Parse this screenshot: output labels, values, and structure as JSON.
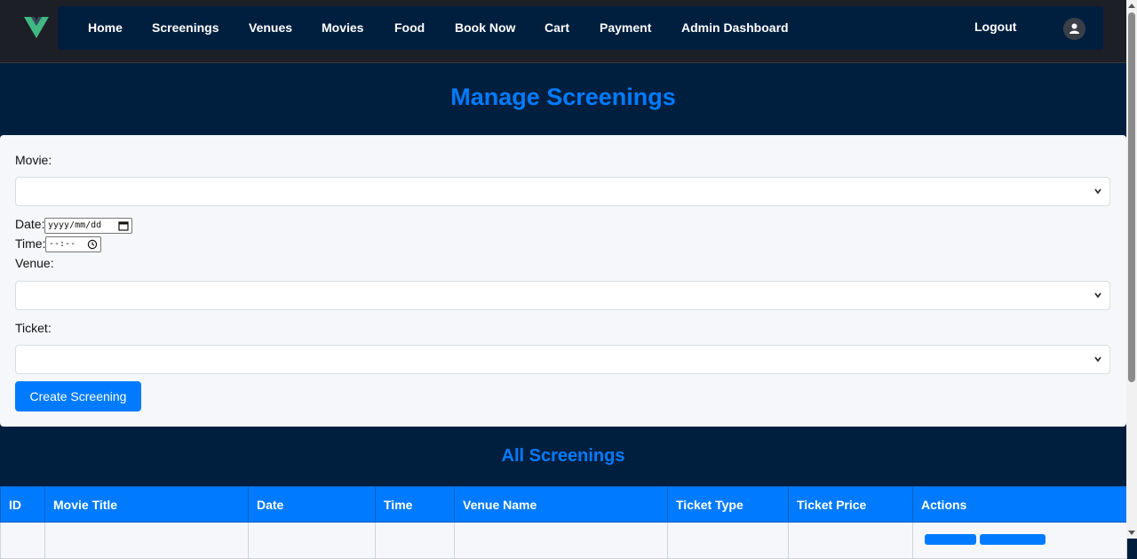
{
  "nav": {
    "items": [
      "Home",
      "Screenings",
      "Venues",
      "Movies",
      "Food",
      "Book Now",
      "Cart",
      "Payment",
      "Admin Dashboard"
    ],
    "logout": "Logout"
  },
  "page": {
    "title": "Manage Screenings"
  },
  "form": {
    "movie_label": "Movie:",
    "date_label": "Date:",
    "date_placeholder": "yyyy/mm/dd",
    "time_label": "Time:",
    "time_placeholder": "--:--",
    "venue_label": "Venue:",
    "ticket_label": "Ticket:",
    "create_button": "Create Screening"
  },
  "list": {
    "title": "All Screenings",
    "columns": [
      "ID",
      "Movie Title",
      "Date",
      "Time",
      "Venue Name",
      "Ticket Type",
      "Ticket Price",
      "Actions"
    ]
  },
  "colors": {
    "accent": "#007bff",
    "page_bg": "#001f3f",
    "topbar_bg": "#1c1f25",
    "logo": "#41b883"
  },
  "icons": [
    "vue-logo-icon",
    "user-icon",
    "chevron-down-icon",
    "calendar-icon",
    "clock-icon"
  ]
}
